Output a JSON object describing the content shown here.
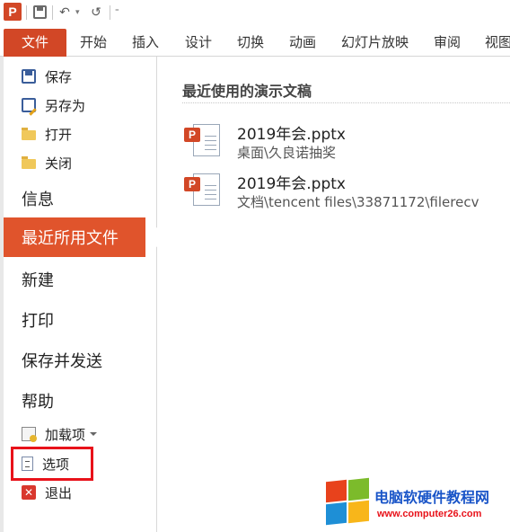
{
  "app": {
    "logo_letter": "P"
  },
  "quick_access": {
    "save": "save-icon",
    "undo": "↶",
    "undo_dropdown": "▾",
    "redo": "↺",
    "customize": "⁼"
  },
  "ribbon": {
    "file_tab": "文件",
    "tabs": [
      "开始",
      "插入",
      "设计",
      "切换",
      "动画",
      "幻灯片放映",
      "审阅",
      "视图"
    ],
    "accent_color": "#d24726"
  },
  "backstage": {
    "small_items_top": [
      {
        "label": "保存",
        "icon": "save-icon"
      },
      {
        "label": "另存为",
        "icon": "save-as-icon"
      },
      {
        "label": "打开",
        "icon": "open-folder-icon"
      },
      {
        "label": "关闭",
        "icon": "close-folder-icon"
      }
    ],
    "info": "信息",
    "recent": "最近所用文件",
    "new": "新建",
    "print": "打印",
    "save_send": "保存并发送",
    "help": "帮助",
    "addins": "加载项",
    "options": "选项",
    "exit": "退出",
    "exit_glyph": "✕"
  },
  "recent_files": {
    "heading": "最近使用的演示文稿",
    "items": [
      {
        "name": "2019年会.pptx",
        "path": "桌面\\久良诺抽奖"
      },
      {
        "name": "2019年会.pptx",
        "path": "文档\\tencent files\\33871172\\filerecv"
      }
    ]
  },
  "watermark": {
    "title": "电脑软硬件教程网",
    "url": "www.computer26.com",
    "colors": [
      "#e8421c",
      "#7cbb2b",
      "#1e8fd6",
      "#f8b61a"
    ]
  }
}
